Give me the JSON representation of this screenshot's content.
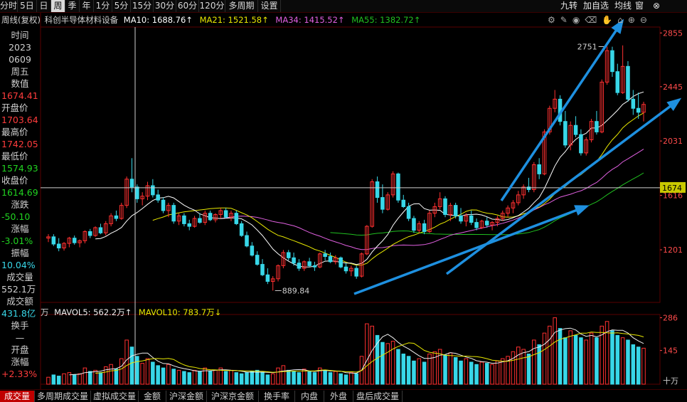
{
  "toolbar": {
    "periods": [
      "分时",
      "5日",
      "日",
      "周",
      "季",
      "年",
      "1分",
      "5分",
      "15分",
      "30分",
      "60分",
      "120分",
      "多周期",
      "设置"
    ],
    "active_period": "周",
    "right_buttons": [
      "九转",
      "加自选",
      "均线",
      "窗",
      "⊗"
    ]
  },
  "legend": {
    "title": "周线(复权)",
    "name": "科创半导体材料设备",
    "ma10": "MA10: 1688.76↑",
    "ma21": "MA21: 1521.58↑",
    "ma34": "MA34: 1415.52↑",
    "ma55": "MA55: 1382.72↑"
  },
  "volume_legend": {
    "unit": "万",
    "mavol5": "MAVOL5: 562.2万↑",
    "mavol10": "MAVOL10: 783.7万↓"
  },
  "info_panel": {
    "time_label": "时间",
    "year": "2023",
    "date": "0609",
    "weekday": "周五",
    "value_label": "数值",
    "value": "1674.41",
    "open_label": "开盘价",
    "open": "1703.64",
    "high_label": "最高价",
    "high": "1742.05",
    "low_label": "最低价",
    "low": "1574.93",
    "close_label": "收盘价",
    "close": "1614.69",
    "change_label": "涨跌",
    "change": "-50.10",
    "pct_label": "涨幅",
    "pct": "-3.01%",
    "amp_label": "振幅",
    "amp": "10.04%",
    "vol_label": "成交量",
    "vol": "552.1万",
    "amount_label": "成交额",
    "amount": "431.8亿",
    "turnover_label": "换手",
    "turnover": "—",
    "open_pct_label": "开盘",
    "open_pct_label2": "涨幅",
    "open_pct": "+2.33%"
  },
  "price_axis": [
    "2855",
    "2445",
    "2031",
    "1616",
    "1201"
  ],
  "crosshair_price": "1674",
  "volume_axis": [
    "286",
    "145"
  ],
  "volume_unit": "十万",
  "annotations": {
    "low_label": "889.84",
    "high_label": "2751"
  },
  "tabs": [
    "成交量",
    "多周期成交量",
    "虚拟成交量",
    "金额",
    "沪深金额",
    "沪深京金额",
    "换手率",
    "内盘",
    "外盘",
    "盘后成交量"
  ],
  "active_tab": "成交量",
  "colors": {
    "up": "#ff3030",
    "down": "#38d7e8",
    "ma10": "#ffffff",
    "ma21": "#e8e800",
    "ma34": "#e060e0",
    "ma55": "#20c020",
    "arrow": "#1e90e0",
    "seq": "#e040e0"
  },
  "chart_data": {
    "type": "candlestick",
    "title": "周线(复权) 科创半导体材料设备",
    "ylim": [
      800,
      2900
    ],
    "min_low": 889.84,
    "max_high": 2751,
    "candles": [
      {
        "o": 1290,
        "h": 1320,
        "l": 1260,
        "c": 1300
      },
      {
        "o": 1300,
        "h": 1320,
        "l": 1230,
        "c": 1245
      },
      {
        "o": 1245,
        "h": 1290,
        "l": 1190,
        "c": 1215
      },
      {
        "o": 1215,
        "h": 1260,
        "l": 1195,
        "c": 1250
      },
      {
        "o": 1250,
        "h": 1300,
        "l": 1220,
        "c": 1290
      },
      {
        "o": 1290,
        "h": 1310,
        "l": 1240,
        "c": 1255
      },
      {
        "o": 1255,
        "h": 1280,
        "l": 1220,
        "c": 1270
      },
      {
        "o": 1270,
        "h": 1350,
        "l": 1250,
        "c": 1340
      },
      {
        "o": 1340,
        "h": 1360,
        "l": 1290,
        "c": 1310
      },
      {
        "o": 1310,
        "h": 1380,
        "l": 1300,
        "c": 1370
      },
      {
        "o": 1370,
        "h": 1400,
        "l": 1320,
        "c": 1330
      },
      {
        "o": 1330,
        "h": 1420,
        "l": 1310,
        "c": 1400
      },
      {
        "o": 1400,
        "h": 1480,
        "l": 1380,
        "c": 1460
      },
      {
        "o": 1460,
        "h": 1500,
        "l": 1420,
        "c": 1440
      },
      {
        "o": 1440,
        "h": 1560,
        "l": 1430,
        "c": 1540
      },
      {
        "o": 1540,
        "h": 1760,
        "l": 1520,
        "c": 1740
      },
      {
        "o": 1740,
        "h": 1900,
        "l": 1640,
        "c": 1680
      },
      {
        "o": 1680,
        "h": 1700,
        "l": 1560,
        "c": 1590
      },
      {
        "o": 1590,
        "h": 1640,
        "l": 1540,
        "c": 1610
      },
      {
        "o": 1610,
        "h": 1720,
        "l": 1580,
        "c": 1690
      },
      {
        "o": 1690,
        "h": 1740,
        "l": 1600,
        "c": 1620
      },
      {
        "o": 1620,
        "h": 1660,
        "l": 1560,
        "c": 1580
      },
      {
        "o": 1580,
        "h": 1600,
        "l": 1480,
        "c": 1500
      },
      {
        "o": 1500,
        "h": 1560,
        "l": 1450,
        "c": 1540
      },
      {
        "o": 1540,
        "h": 1560,
        "l": 1400,
        "c": 1420
      },
      {
        "o": 1420,
        "h": 1480,
        "l": 1390,
        "c": 1460
      },
      {
        "o": 1460,
        "h": 1480,
        "l": 1380,
        "c": 1400
      },
      {
        "o": 1400,
        "h": 1430,
        "l": 1350,
        "c": 1380
      },
      {
        "o": 1380,
        "h": 1460,
        "l": 1370,
        "c": 1440
      },
      {
        "o": 1440,
        "h": 1480,
        "l": 1400,
        "c": 1410
      },
      {
        "o": 1410,
        "h": 1500,
        "l": 1390,
        "c": 1480
      },
      {
        "o": 1480,
        "h": 1500,
        "l": 1420,
        "c": 1430
      },
      {
        "o": 1430,
        "h": 1480,
        "l": 1410,
        "c": 1470
      },
      {
        "o": 1470,
        "h": 1520,
        "l": 1440,
        "c": 1500
      },
      {
        "o": 1500,
        "h": 1520,
        "l": 1440,
        "c": 1450
      },
      {
        "o": 1450,
        "h": 1500,
        "l": 1420,
        "c": 1480
      },
      {
        "o": 1480,
        "h": 1500,
        "l": 1390,
        "c": 1400
      },
      {
        "o": 1400,
        "h": 1420,
        "l": 1300,
        "c": 1310
      },
      {
        "o": 1310,
        "h": 1340,
        "l": 1220,
        "c": 1230
      },
      {
        "o": 1230,
        "h": 1260,
        "l": 1150,
        "c": 1160
      },
      {
        "o": 1160,
        "h": 1190,
        "l": 1080,
        "c": 1090
      },
      {
        "o": 1090,
        "h": 1130,
        "l": 1000,
        "c": 1010
      },
      {
        "o": 1010,
        "h": 1060,
        "l": 940,
        "c": 960
      },
      {
        "o": 960,
        "h": 1000,
        "l": 889.84,
        "c": 980
      },
      {
        "o": 980,
        "h": 1090,
        "l": 960,
        "c": 1080
      },
      {
        "o": 1080,
        "h": 1200,
        "l": 1060,
        "c": 1180
      },
      {
        "o": 1180,
        "h": 1200,
        "l": 1120,
        "c": 1140
      },
      {
        "o": 1140,
        "h": 1180,
        "l": 1080,
        "c": 1100
      },
      {
        "o": 1100,
        "h": 1130,
        "l": 1040,
        "c": 1060
      },
      {
        "o": 1060,
        "h": 1120,
        "l": 1040,
        "c": 1110
      },
      {
        "o": 1110,
        "h": 1140,
        "l": 1070,
        "c": 1080
      },
      {
        "o": 1080,
        "h": 1110,
        "l": 1040,
        "c": 1070
      },
      {
        "o": 1070,
        "h": 1180,
        "l": 1060,
        "c": 1170
      },
      {
        "o": 1170,
        "h": 1200,
        "l": 1120,
        "c": 1150
      },
      {
        "o": 1150,
        "h": 1180,
        "l": 1100,
        "c": 1110
      },
      {
        "o": 1110,
        "h": 1160,
        "l": 1090,
        "c": 1140
      },
      {
        "o": 1140,
        "h": 1150,
        "l": 1060,
        "c": 1070
      },
      {
        "o": 1070,
        "h": 1100,
        "l": 1020,
        "c": 1040
      },
      {
        "o": 1040,
        "h": 1080,
        "l": 1000,
        "c": 1060
      },
      {
        "o": 1060,
        "h": 1080,
        "l": 980,
        "c": 1000
      },
      {
        "o": 1000,
        "h": 1180,
        "l": 990,
        "c": 1170
      },
      {
        "o": 1170,
        "h": 1390,
        "l": 1160,
        "c": 1380
      },
      {
        "o": 1380,
        "h": 1740,
        "l": 1370,
        "c": 1720
      },
      {
        "o": 1720,
        "h": 1760,
        "l": 1560,
        "c": 1600
      },
      {
        "o": 1600,
        "h": 1700,
        "l": 1480,
        "c": 1510
      },
      {
        "o": 1510,
        "h": 1640,
        "l": 1500,
        "c": 1620
      },
      {
        "o": 1620,
        "h": 1800,
        "l": 1600,
        "c": 1780
      },
      {
        "o": 1780,
        "h": 1790,
        "l": 1560,
        "c": 1580
      },
      {
        "o": 1580,
        "h": 1620,
        "l": 1520,
        "c": 1530
      },
      {
        "o": 1530,
        "h": 1560,
        "l": 1420,
        "c": 1440
      },
      {
        "o": 1440,
        "h": 1460,
        "l": 1330,
        "c": 1350
      },
      {
        "o": 1350,
        "h": 1420,
        "l": 1330,
        "c": 1400
      },
      {
        "o": 1400,
        "h": 1430,
        "l": 1320,
        "c": 1340
      },
      {
        "o": 1340,
        "h": 1500,
        "l": 1330,
        "c": 1480
      },
      {
        "o": 1480,
        "h": 1560,
        "l": 1450,
        "c": 1530
      },
      {
        "o": 1530,
        "h": 1640,
        "l": 1510,
        "c": 1590
      },
      {
        "o": 1590,
        "h": 1610,
        "l": 1450,
        "c": 1470
      },
      {
        "o": 1470,
        "h": 1560,
        "l": 1420,
        "c": 1540
      },
      {
        "o": 1540,
        "h": 1560,
        "l": 1440,
        "c": 1460
      },
      {
        "o": 1460,
        "h": 1520,
        "l": 1400,
        "c": 1420
      },
      {
        "o": 1420,
        "h": 1480,
        "l": 1380,
        "c": 1460
      },
      {
        "o": 1460,
        "h": 1500,
        "l": 1390,
        "c": 1410
      },
      {
        "o": 1410,
        "h": 1440,
        "l": 1350,
        "c": 1370
      },
      {
        "o": 1370,
        "h": 1430,
        "l": 1360,
        "c": 1420
      },
      {
        "o": 1420,
        "h": 1450,
        "l": 1370,
        "c": 1390
      },
      {
        "o": 1390,
        "h": 1420,
        "l": 1350,
        "c": 1410
      },
      {
        "o": 1410,
        "h": 1460,
        "l": 1380,
        "c": 1440
      },
      {
        "o": 1440,
        "h": 1500,
        "l": 1420,
        "c": 1480
      },
      {
        "o": 1480,
        "h": 1540,
        "l": 1450,
        "c": 1520
      },
      {
        "o": 1520,
        "h": 1580,
        "l": 1480,
        "c": 1560
      },
      {
        "o": 1560,
        "h": 1650,
        "l": 1540,
        "c": 1620
      },
      {
        "o": 1620,
        "h": 1700,
        "l": 1590,
        "c": 1680
      },
      {
        "o": 1680,
        "h": 1750,
        "l": 1640,
        "c": 1660
      },
      {
        "o": 1660,
        "h": 1870,
        "l": 1640,
        "c": 1850
      },
      {
        "o": 1850,
        "h": 1900,
        "l": 1740,
        "c": 1780
      },
      {
        "o": 1780,
        "h": 2120,
        "l": 1770,
        "c": 2100
      },
      {
        "o": 2100,
        "h": 2300,
        "l": 2080,
        "c": 2280
      },
      {
        "o": 2280,
        "h": 2420,
        "l": 2250,
        "c": 2350
      },
      {
        "o": 2350,
        "h": 2380,
        "l": 2150,
        "c": 2180
      },
      {
        "o": 2180,
        "h": 2260,
        "l": 1980,
        "c": 2000
      },
      {
        "o": 2000,
        "h": 2180,
        "l": 1960,
        "c": 2150
      },
      {
        "o": 2150,
        "h": 2220,
        "l": 2060,
        "c": 2080
      },
      {
        "o": 2080,
        "h": 2120,
        "l": 1920,
        "c": 1940
      },
      {
        "o": 1940,
        "h": 2060,
        "l": 1920,
        "c": 2040
      },
      {
        "o": 2040,
        "h": 2200,
        "l": 2020,
        "c": 2180
      },
      {
        "o": 2180,
        "h": 2260,
        "l": 2080,
        "c": 2100
      },
      {
        "o": 2100,
        "h": 2500,
        "l": 2090,
        "c": 2480
      },
      {
        "o": 2480,
        "h": 2751,
        "l": 2460,
        "c": 2720
      },
      {
        "o": 2720,
        "h": 2750,
        "l": 2520,
        "c": 2560
      },
      {
        "o": 2560,
        "h": 2620,
        "l": 2380,
        "c": 2400
      },
      {
        "o": 2400,
        "h": 2760,
        "l": 2390,
        "c": 2600
      },
      {
        "o": 2600,
        "h": 2640,
        "l": 2330,
        "c": 2350
      },
      {
        "o": 2350,
        "h": 2420,
        "l": 2230,
        "c": 2280
      },
      {
        "o": 2280,
        "h": 2400,
        "l": 2200,
        "c": 2250
      },
      {
        "o": 2250,
        "h": 2330,
        "l": 2180,
        "c": 2310
      }
    ],
    "volume": [
      30,
      40,
      35,
      45,
      50,
      40,
      45,
      70,
      55,
      60,
      50,
      75,
      85,
      65,
      110,
      190,
      160,
      120,
      90,
      110,
      95,
      80,
      70,
      85,
      65,
      60,
      55,
      50,
      60,
      55,
      70,
      55,
      60,
      70,
      55,
      60,
      50,
      45,
      50,
      55,
      60,
      50,
      40,
      45,
      70,
      80,
      60,
      55,
      50,
      65,
      55,
      50,
      70,
      60,
      50,
      55,
      45,
      40,
      50,
      45,
      120,
      260,
      250,
      210,
      180,
      175,
      185,
      150,
      130,
      120,
      100,
      110,
      95,
      130,
      140,
      150,
      125,
      135,
      115,
      100,
      110,
      95,
      85,
      95,
      90,
      85,
      100,
      110,
      120,
      140,
      160,
      150,
      130,
      190,
      170,
      220,
      250,
      286,
      240,
      200,
      230,
      210,
      200,
      190,
      220,
      200,
      250,
      270,
      230,
      210,
      200,
      190,
      170,
      160,
      155
    ]
  }
}
